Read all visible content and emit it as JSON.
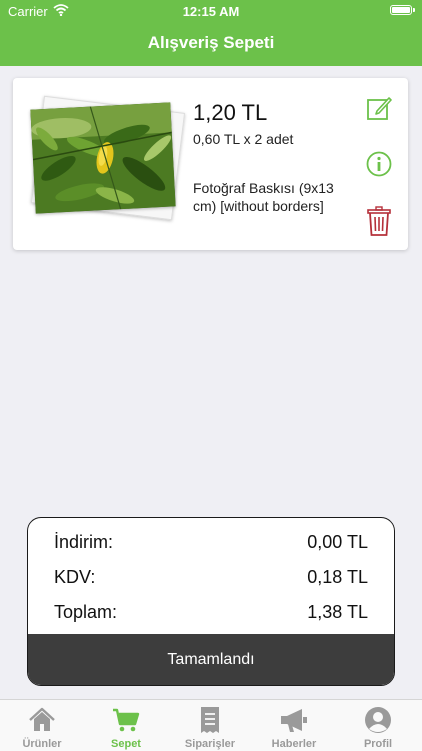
{
  "status_bar": {
    "carrier": "Carrier",
    "time": "12:15 AM"
  },
  "header": {
    "title": "Alışveriş Sepeti"
  },
  "cart_item": {
    "price": "1,20 TL",
    "quantity_line": "0,60 TL x 2 adet",
    "description": "Fotoğraf Baskısı (9x13 cm) [without borders]",
    "image": "plant-leaves-photo",
    "icons": [
      "edit-icon",
      "info-icon",
      "trash-icon"
    ]
  },
  "summary": {
    "discount_label": "İndirim:",
    "discount_value": "0,00 TL",
    "tax_label": "KDV:",
    "tax_value": "0,18 TL",
    "total_label": "Toplam:",
    "total_value": "1,38 TL",
    "complete_button": "Tamamlandı"
  },
  "tabs": [
    {
      "label": "Ürünler",
      "icon": "home-icon",
      "active": false
    },
    {
      "label": "Sepet",
      "icon": "cart-icon",
      "active": true
    },
    {
      "label": "Siparişler",
      "icon": "orders-icon",
      "active": false
    },
    {
      "label": "Haberler",
      "icon": "megaphone-icon",
      "active": false
    },
    {
      "label": "Profil",
      "icon": "profile-icon",
      "active": false
    }
  ],
  "colors": {
    "accent": "#6cc14a",
    "delete": "#b5303a",
    "dark_button": "#3d3d3d"
  }
}
